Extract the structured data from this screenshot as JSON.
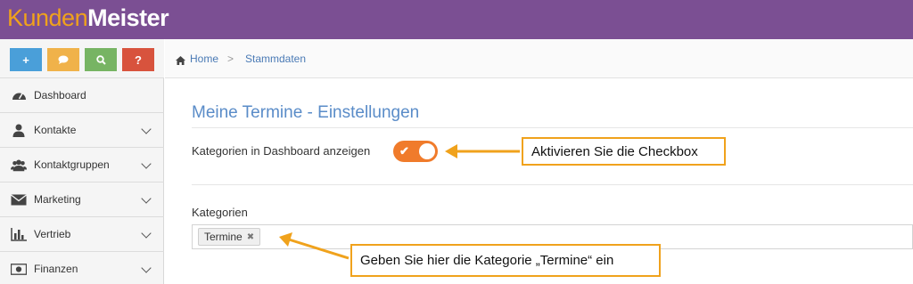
{
  "app": {
    "logo_part1": "Kunden",
    "logo_part2": "Meister"
  },
  "quick_actions": [
    {
      "glyph": "+",
      "icon": "plus-icon",
      "color": "#4a9fd9"
    },
    {
      "glyph": "💬",
      "icon": "chat-icon",
      "color": "#f0b24a"
    },
    {
      "glyph": "🔍",
      "icon": "search-icon",
      "color": "#77b463"
    },
    {
      "glyph": "?",
      "icon": "help-icon",
      "color": "#d8533d"
    }
  ],
  "sidebar": {
    "items": [
      {
        "label": "Dashboard",
        "icon": "dashboard-icon"
      },
      {
        "label": "Kontakte",
        "icon": "user-icon"
      },
      {
        "label": "Kontaktgruppen",
        "icon": "users-icon"
      },
      {
        "label": "Marketing",
        "icon": "envelope-icon"
      },
      {
        "label": "Vertrieb",
        "icon": "bar-chart-icon"
      },
      {
        "label": "Finanzen",
        "icon": "money-icon"
      }
    ]
  },
  "breadcrumb": {
    "home": "Home",
    "current": "Stammdaten"
  },
  "main": {
    "title": "Meine Termine - Einstellungen",
    "toggle_label": "Kategorien in Dashboard anzeigen",
    "toggle_on": true,
    "categories_label": "Kategorien",
    "tags": [
      "Termine"
    ]
  },
  "annotations": {
    "callout1": "Aktivieren Sie die Checkbox",
    "callout2": "Geben Sie hier die Kategorie „Termine“ ein"
  },
  "colors": {
    "topbar": "#7b4f93",
    "accent": "#f07b2b",
    "callout_border": "#f0a21c",
    "title": "#5a8cc8"
  }
}
